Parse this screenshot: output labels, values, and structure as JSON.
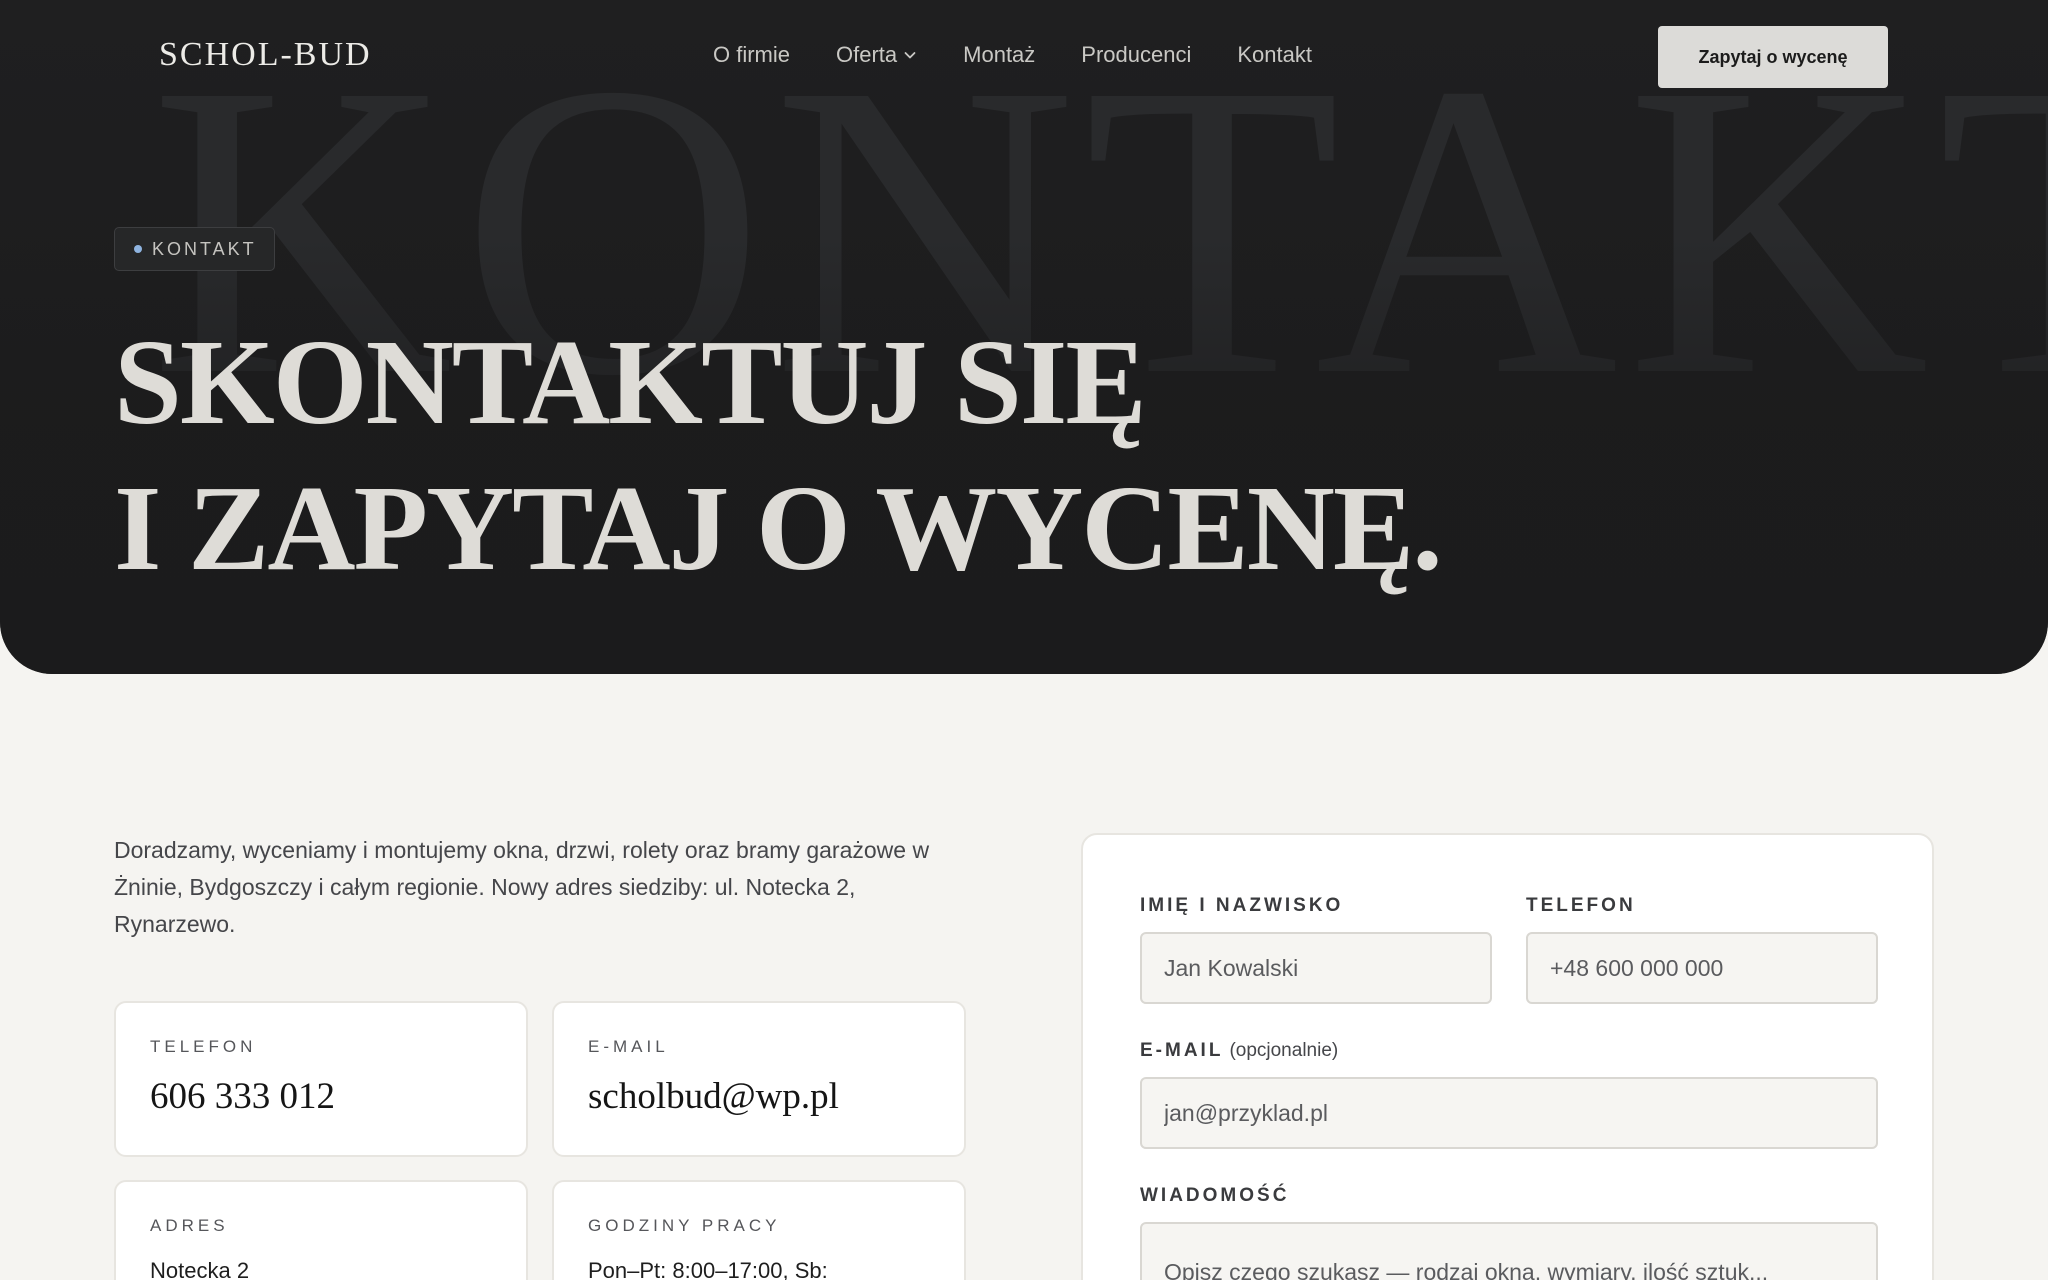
{
  "brand": {
    "logo": "SCHOL-BUD"
  },
  "nav": {
    "items": [
      {
        "label": "O firmie"
      },
      {
        "label": "Oferta"
      },
      {
        "label": "Montaż"
      },
      {
        "label": "Producenci"
      },
      {
        "label": "Kontakt"
      }
    ],
    "cta_label": "Zapytaj o wycenę"
  },
  "hero": {
    "watermark": "KONTAKT",
    "badge": "KONTAKT",
    "title_line1": "Skontaktuj się",
    "title_line2": "i zapytaj o wycenę."
  },
  "intro": {
    "text": "Doradzamy, wyceniamy i montujemy okna, drzwi, rolety oraz bramy garażowe w Żninie, Bydgoszczy i całym regionie. Nowy adres siedziby: ul. Notecka 2, Rynarzewo."
  },
  "contact_cards": {
    "phone": {
      "label": "TELEFON",
      "value": "606 333 012"
    },
    "email": {
      "label": "E-MAIL",
      "value": "scholbud@wp.pl"
    },
    "address": {
      "label": "ADRES",
      "value": "Notecka 2"
    },
    "hours": {
      "label": "GODZINY PRACY",
      "value": "Pon–Pt: 8:00–17:00, Sb:"
    }
  },
  "form": {
    "name": {
      "label": "IMIĘ I NAZWISKO",
      "placeholder": "Jan Kowalski"
    },
    "phone": {
      "label": "TELEFON",
      "placeholder": "+48 600 000 000"
    },
    "email": {
      "label": "E-MAIL",
      "optional": "(opcjonalnie)",
      "placeholder": "jan@przyklad.pl"
    },
    "message": {
      "label": "WIADOMOŚĆ",
      "placeholder": "Opisz czego szukasz — rodzaj okna, wymiary, ilość sztuk..."
    }
  }
}
